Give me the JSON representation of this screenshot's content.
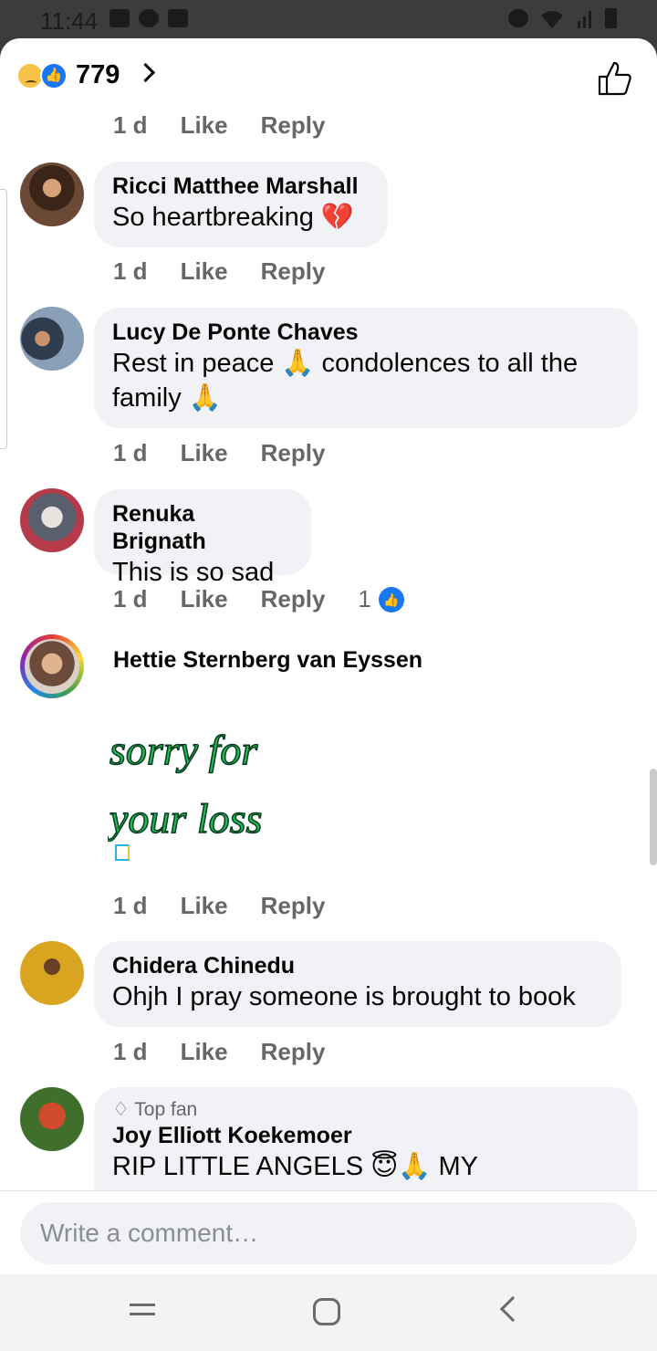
{
  "status_bar": {
    "time": "11:44"
  },
  "header": {
    "reaction_count": "779",
    "reactions": [
      "sad",
      "like"
    ]
  },
  "comments": [
    {
      "name": "Ricci Matthee Marshall",
      "text": "So heartbreaking 💔",
      "time": "1 d",
      "like": "Like",
      "reply": "Reply"
    },
    {
      "name": "Lucy De Ponte Chaves",
      "text_line1": "Rest in peace 🙏 condolences to all the",
      "text_line2": "family 🙏",
      "time": "1 d",
      "like": "Like",
      "reply": "Reply"
    },
    {
      "name": "Renuka Brignath",
      "text": "This is so sad",
      "time": "1 d",
      "like": "Like",
      "reply": "Reply",
      "like_count": "1"
    },
    {
      "name": "Hettie Sternberg van Eyssen",
      "sticker_line1": "sorry for",
      "sticker_line2": "your loss",
      "time": "1 d",
      "like": "Like",
      "reply": "Reply"
    },
    {
      "name": "Chidera Chinedu",
      "text": "Ohjh I pray someone is brought to book",
      "time": "1 d",
      "like": "Like",
      "reply": "Reply"
    },
    {
      "badge": "Top fan",
      "name": "Joy Elliott Koekemoer",
      "text": "RIP LITTLE ANGELS 😇🙏 MY"
    }
  ],
  "prev_actions": {
    "time": "1 d",
    "like": "Like",
    "reply": "Reply"
  },
  "composer": {
    "placeholder": "Write a comment…"
  },
  "colors": {
    "accent": "#1877f2",
    "bubble": "#f0f2f5",
    "meta_text": "#65676b",
    "sticker_green": "#1db954"
  }
}
